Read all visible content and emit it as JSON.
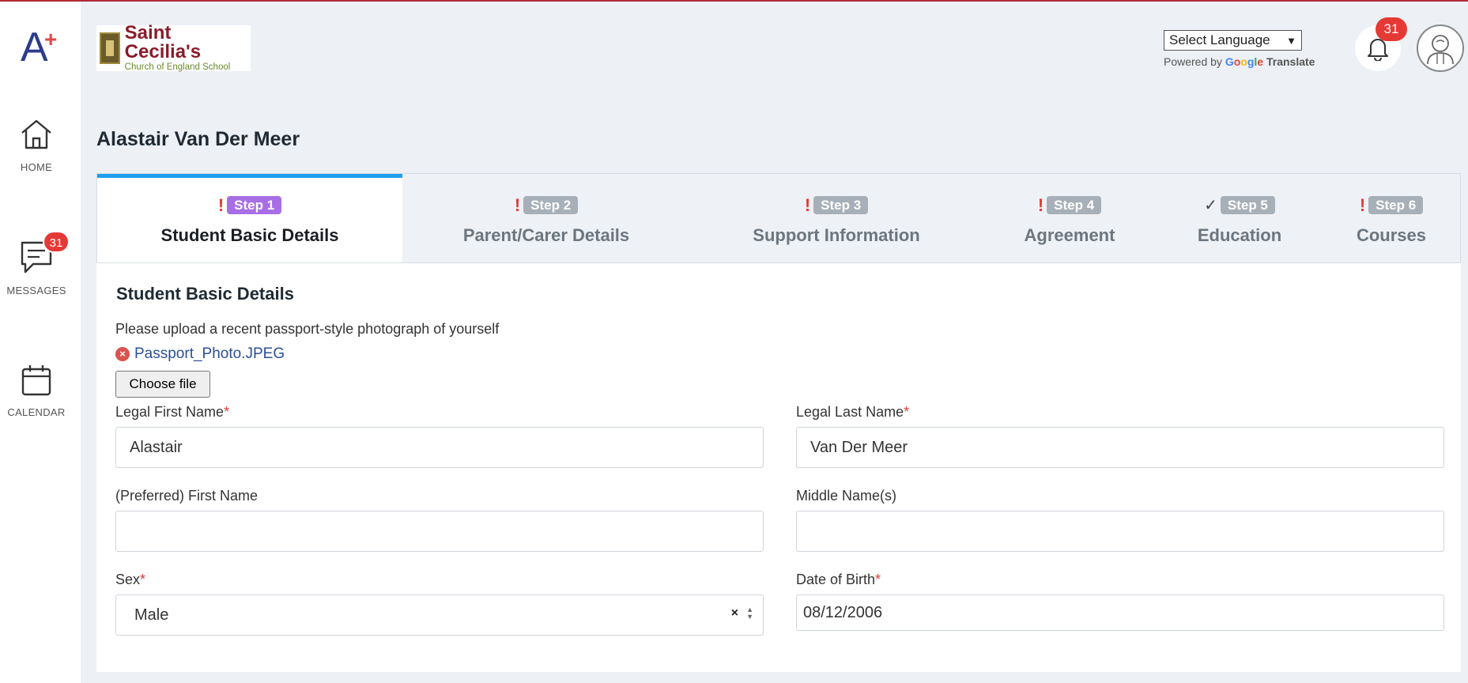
{
  "sidebar": {
    "logo_letter": "A",
    "logo_plus": "+",
    "items": [
      {
        "label": "HOME"
      },
      {
        "label": "MESSAGES",
        "badge": "31"
      },
      {
        "label": "CALENDAR"
      }
    ]
  },
  "header": {
    "school_name": "Saint Cecilia's",
    "school_subtitle": "Church of England School",
    "language_select": "Select Language",
    "powered_by": "Powered by",
    "google": [
      "G",
      "o",
      "o",
      "g",
      "l",
      "e"
    ],
    "translate": "Translate",
    "notification_count": "31"
  },
  "page": {
    "title": "Alastair Van Der Meer"
  },
  "tabs": [
    {
      "status": "!",
      "step": "Step 1",
      "title": "Student Basic Details"
    },
    {
      "status": "!",
      "step": "Step 2",
      "title": "Parent/Carer Details"
    },
    {
      "status": "!",
      "step": "Step 3",
      "title": "Support Information"
    },
    {
      "status": "!",
      "step": "Step 4",
      "title": "Agreement"
    },
    {
      "status": "✓",
      "step": "Step 5",
      "title": "Education"
    },
    {
      "status": "!",
      "step": "Step 6",
      "title": "Courses"
    }
  ],
  "form": {
    "section_title": "Student Basic Details",
    "upload_text": "Please upload a recent passport-style photograph of yourself",
    "file_name": "Passport_Photo.JPEG",
    "choose_file": "Choose file",
    "required_mark": "*",
    "legal_first_name": {
      "label": "Legal First Name",
      "value": "Alastair"
    },
    "legal_last_name": {
      "label": "Legal Last Name",
      "value": "Van Der Meer"
    },
    "preferred_first_name": {
      "label": "(Preferred) First Name",
      "value": ""
    },
    "middle_names": {
      "label": "Middle Name(s)",
      "value": ""
    },
    "sex": {
      "label": "Sex",
      "value": "Male",
      "clear": "×"
    },
    "dob": {
      "label": "Date of Birth",
      "value": "08/12/2006"
    }
  },
  "colors": {
    "accent": "#1e9ef0",
    "active_step": "#a86ee6",
    "inactive_step": "#a7b0b8",
    "error": "#e53935",
    "brand": "#8a1c2a"
  }
}
